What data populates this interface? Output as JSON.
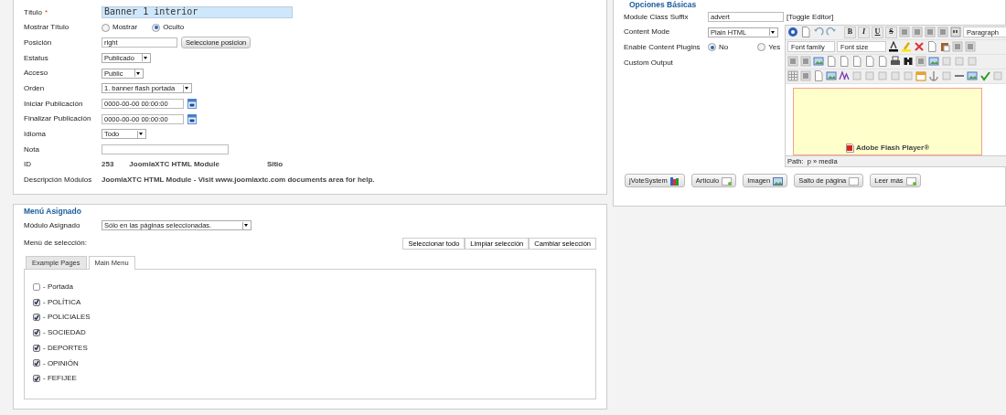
{
  "details": {
    "fields": [
      {
        "label": "Título",
        "required": true,
        "required_mark": "*",
        "kind": "title",
        "value": "Banner 1 interior"
      },
      {
        "label": "Mostrar Título",
        "kind": "radio",
        "options": [
          {
            "label": "Mostrar",
            "selected": false
          },
          {
            "label": "Oculto",
            "selected": true
          }
        ]
      },
      {
        "label": "Posición",
        "kind": "text_button",
        "value": "right",
        "button": "Seleccione posicion"
      },
      {
        "label": "Estatus",
        "kind": "select",
        "value": "Publicado"
      },
      {
        "label": "Acceso",
        "kind": "select",
        "value": "Public"
      },
      {
        "label": "Orden",
        "kind": "select",
        "value": "1. banner flash portada"
      },
      {
        "label": "Iniciar Publicación",
        "kind": "date",
        "value": "0000-00-00 00:00:00"
      },
      {
        "label": "Finalizar Publicación",
        "kind": "date",
        "value": "0000-00-00 00:00:00"
      },
      {
        "label": "Idioma",
        "kind": "select",
        "value": "Todo"
      },
      {
        "label": "Nota",
        "kind": "text"
      },
      {
        "label": "ID",
        "kind": "info",
        "values": [
          "253",
          "JoomlaXTC HTML Module",
          "Sitio"
        ]
      },
      {
        "label": "Descripción Módulos",
        "kind": "info",
        "values": [
          "JoomlaXTC HTML Module - Visit www.joomlaxtc.com documents area for help."
        ]
      }
    ]
  },
  "basic_options": {
    "title": "Opciones Básicas",
    "fields": [
      {
        "label": "Module Class Suffix",
        "kind": "text_link",
        "value": "advert",
        "link": "[Toggle Editor]"
      },
      {
        "label": "Content Mode",
        "kind": "select",
        "value": "Plain HTML"
      },
      {
        "label": "Enable Content Plugins",
        "kind": "radio",
        "options": [
          {
            "label": "No",
            "selected": true
          },
          {
            "label": "Yes",
            "selected": false
          }
        ]
      },
      {
        "label": "Custom Output",
        "kind": "editor"
      }
    ],
    "editor": {
      "format_buttons": [
        "B",
        "I",
        "U",
        "S"
      ],
      "block_format": "Paragraph",
      "font_family": "Font family",
      "font_size": "Font size",
      "placeholder_label": "Adobe Flash Player®",
      "path": "Path:  p » media"
    },
    "buttons": [
      "jVoteSystem",
      "Artículo",
      "Imagen",
      "Salto de página",
      "Leer más"
    ]
  },
  "menu_assignment": {
    "title": "Menú Asignado",
    "assignment": {
      "label": "Módulo Asignado",
      "value": "Sólo en las páginas seleccionadas."
    },
    "selection_label": "Menú de selección:",
    "selection_buttons": [
      "Seleccionar todo",
      "Limpiar selección",
      "Cambiar selección"
    ],
    "tabs": [
      {
        "label": "Example Pages",
        "selected": false
      },
      {
        "label": "Main Menu",
        "selected": true
      }
    ],
    "items": [
      {
        "label": "- Portada",
        "checked": false
      },
      {
        "label": "- POLÍTICA",
        "checked": true
      },
      {
        "label": "- POLICIALES",
        "checked": true
      },
      {
        "label": "- SOCIEDAD",
        "checked": true
      },
      {
        "label": "- DEPORTES",
        "checked": true
      },
      {
        "label": "- OPINIÓN",
        "checked": true
      },
      {
        "label": "- FEFIJEE",
        "checked": true
      }
    ]
  }
}
